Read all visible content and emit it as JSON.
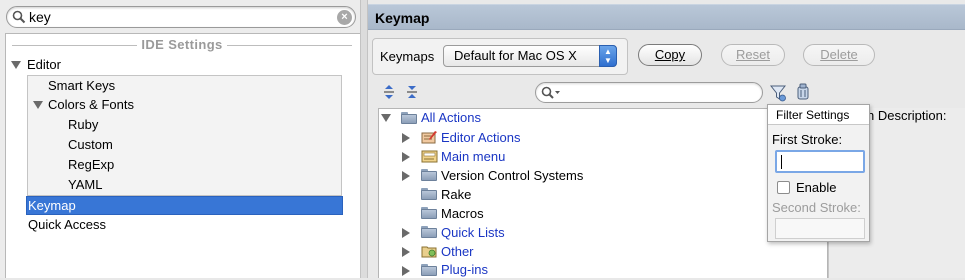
{
  "search": {
    "value": "key"
  },
  "settings_tree": {
    "section_header": "IDE Settings",
    "items": [
      {
        "label": "Editor"
      },
      {
        "label": "Smart Keys"
      },
      {
        "label": "Colors & Fonts"
      },
      {
        "label": "Ruby"
      },
      {
        "label": "Custom"
      },
      {
        "label": "RegExp"
      },
      {
        "label": "YAML"
      },
      {
        "label": "Keymap"
      },
      {
        "label": "Quick Access"
      }
    ]
  },
  "panel": {
    "title": "Keymap"
  },
  "keymaps": {
    "label": "Keymaps",
    "selected": "Default for Mac OS X",
    "buttons": {
      "copy": "Copy",
      "reset": "Reset",
      "delete": "Delete"
    }
  },
  "actions_tree": {
    "root": "All Actions",
    "items": [
      {
        "label": "Editor Actions"
      },
      {
        "label": "Main menu"
      },
      {
        "label": "Version Control Systems"
      },
      {
        "label": "Rake"
      },
      {
        "label": "Macros"
      },
      {
        "label": "Quick Lists"
      },
      {
        "label": "Other"
      },
      {
        "label": "Plug-ins"
      }
    ]
  },
  "description_label_fragment": "n Description:",
  "filter_popup": {
    "title": "Filter Settings",
    "first_stroke_label": "First Stroke:",
    "enable_label": "Enable",
    "second_stroke_label": "Second Stroke:"
  },
  "colors": {
    "selection": "#3876d6",
    "link_text": "#1a36c4",
    "header_bg": "#b9c7d8"
  }
}
